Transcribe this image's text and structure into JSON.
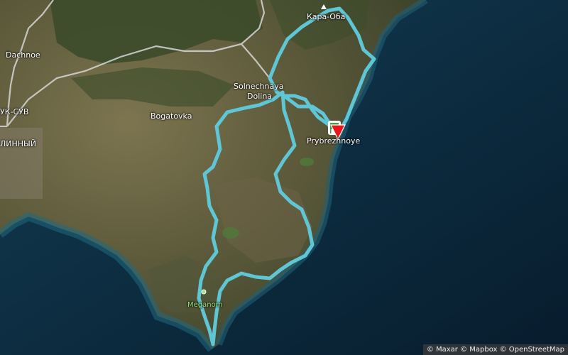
{
  "labels": {
    "dachnoe": "Dachnoe",
    "bogatovka": "Bogatovka",
    "solnechnaya": "Solnechnaya",
    "dolina": "Dolina",
    "kara_oba": "Кара-Оба",
    "prybrezhnoye": "Prybrezhnoye",
    "meganom": "Meganom",
    "suk_suv": "УК-СУВ",
    "dlinnyi": "ЛИННЫЙ"
  },
  "attribution": "© Maxar © Mapbox © OpenStreetMap",
  "colors": {
    "route": "#5fc6d6",
    "sea": "#0c2f48",
    "land": "#6b6a4a",
    "road": "#d9d9d9",
    "start_flag": "#3aa640",
    "end_marker": "#e8161b"
  },
  "icons": {
    "start": "green-flag-icon",
    "end": "red-pin-icon",
    "peak": "mountain-peak-icon",
    "viewpoint": "viewpoint-dot-icon"
  }
}
